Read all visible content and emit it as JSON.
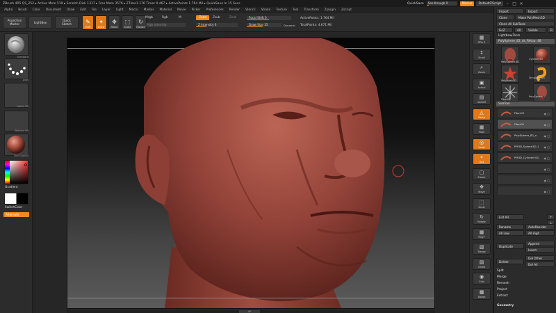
{
  "titlebar": {
    "text": "ZBrush 4R5    QS_252    ▸ Active Mem 519  ▸ Scratch Disk 1317  ▸ Free Mem 3576  ▸ ZTime1.176  Timer 0.467  ▸ ActivePoints 1.764 Mil  ▸ QuickSave In 15 Secs",
    "quicksave": "QuickSave",
    "seethrough_label": "See-through",
    "seethrough_value": "0",
    "seethrough_fraction": 0.08,
    "menus_button": "Menus",
    "script_button": "DefaultZScript"
  },
  "menubar": [
    "Alpha",
    "Brush",
    "Color",
    "Document",
    "Draw",
    "Edit",
    "File",
    "Layer",
    "Light",
    "Macro",
    "Marker",
    "Material",
    "Movie",
    "Picker",
    "Preferences",
    "Render",
    "Stencil",
    "Stroke",
    "Texture",
    "Tool",
    "Transform",
    "Zplugin",
    "Zscript"
  ],
  "toolbar": {
    "projection_master": "Projection\nMaster",
    "lightbox": "LightBox",
    "quick_sketch": "Quick\nSketch",
    "tools": [
      {
        "label": "Edit",
        "glyph": "✎",
        "active": true
      },
      {
        "label": "Draw",
        "glyph": "✦",
        "active": true
      },
      {
        "label": "Move",
        "glyph": "✥",
        "active": false
      },
      {
        "label": "Scale",
        "glyph": "⬚",
        "active": false
      },
      {
        "label": "Rotate",
        "glyph": "↻",
        "active": false
      }
    ],
    "mrgb": "Mrgb",
    "rgb": "Rgb",
    "m": "M",
    "rgb_intensity": "Rgb Intensity",
    "zadd": "Zadd",
    "zsub": "Zsub",
    "zcut": "Zcut",
    "z_intensity": "Z Intensity 6",
    "z_intensity_fraction": 0.25,
    "focal_shift": "Focal Shift 0",
    "focal_fraction": 0.5,
    "draw_size": "Draw Size 35",
    "draw_size_fraction": 0.45,
    "dynamic": "Dynamic",
    "active_points": "ActivePoints: 1.764 Mil",
    "total_points": "TotalPoints: 4.671 Mil"
  },
  "leftshelf": {
    "captions": [
      "Standard",
      "Dots",
      "Alpha Off",
      "Texture Off",
      "SkinShade4"
    ],
    "gradient": "Gradient",
    "switch_color": "SwitchColor",
    "alternate": "Alternate"
  },
  "canvas": {
    "grip_label": "AP"
  },
  "rightshelf": [
    {
      "label": "SPix 3",
      "glyph": "▦",
      "or": false
    },
    {
      "label": "Scroll",
      "glyph": "↕",
      "or": false
    },
    {
      "label": "Zoom",
      "glyph": "⌕",
      "or": false
    },
    {
      "label": "Actual",
      "glyph": "▣",
      "or": false
    },
    {
      "label": "AAHalf",
      "glyph": "▤",
      "or": false
    },
    {
      "label": "Persp",
      "glyph": "△",
      "or": true
    },
    {
      "label": "Floor",
      "glyph": "▦",
      "or": false
    },
    {
      "label": "Local",
      "glyph": "◎",
      "or": true
    },
    {
      "label": "Gyz",
      "glyph": "⌖",
      "or": true
    },
    {
      "label": "Frame",
      "glyph": "▢",
      "or": false
    },
    {
      "label": "Move",
      "glyph": "✥",
      "or": false
    },
    {
      "label": "Scale",
      "glyph": "⬚",
      "or": false
    },
    {
      "label": "Rotate",
      "glyph": "↻",
      "or": false
    },
    {
      "label": "PolyF",
      "glyph": "▦",
      "or": false
    },
    {
      "label": "Transp",
      "glyph": "▧",
      "or": false
    },
    {
      "label": "Ghost",
      "glyph": "▨",
      "or": false
    },
    {
      "label": "Solo",
      "glyph": "◉",
      "or": false
    },
    {
      "label": "Xpose",
      "glyph": "▩",
      "or": false
    }
  ],
  "palette": {
    "import": "Import",
    "export": "Export",
    "clone": "Clone",
    "make_polymesh": "Make PolyMesh3D",
    "clone_all_subtools": "Clone All SubTools",
    "goz": "GoZ",
    "all": "All",
    "visible": "Visible",
    "r": "R",
    "lightbox_tools": "Lightbox▸Tools",
    "current_tool": "PolySphere_82_ok_Retop. 48",
    "tools": [
      {
        "name": "PolySphere_82",
        "kind": "head"
      },
      {
        "name": "Cylinder3D",
        "kind": "sphere"
      },
      {
        "name": "PolyMesh3D",
        "kind": "star"
      },
      {
        "name": "SimpleBrush",
        "kind": "brush"
      },
      {
        "name": "Fiber01",
        "kind": "star2"
      },
      {
        "name": "PolySphere",
        "kind": "head2"
      }
    ],
    "subtool_header": "SubTool",
    "subtools": [
      {
        "name": "Fiber03",
        "sel": false
      },
      {
        "name": "Fiber02",
        "sel": true
      },
      {
        "name": "PolySphere_82_o",
        "sel": false
      },
      {
        "name": "PM3D_Sphere3D_1",
        "sel": false
      },
      {
        "name": "PM3D_Cylinder3D1",
        "sel": false
      },
      {
        "name": "",
        "sel": false
      },
      {
        "name": "",
        "sel": false
      },
      {
        "name": "",
        "sel": false
      }
    ],
    "list_all": "List All",
    "rename": "Rename",
    "auto_reorder": "AutoReorder",
    "all_low": "All Low",
    "all_high": "All High",
    "duplicate": "Duplicate",
    "append": "Append",
    "insert": "Insert",
    "delete": "Delete",
    "del_other": "Del Other",
    "del_all": "Del All",
    "split": "Split",
    "merge": "Merge",
    "remesh": "Remesh",
    "project": "Project",
    "extract": "Extract",
    "geometry": "Geometry"
  },
  "colors": {
    "accent": "#f08a1c",
    "skin": "#9a4a3f"
  }
}
